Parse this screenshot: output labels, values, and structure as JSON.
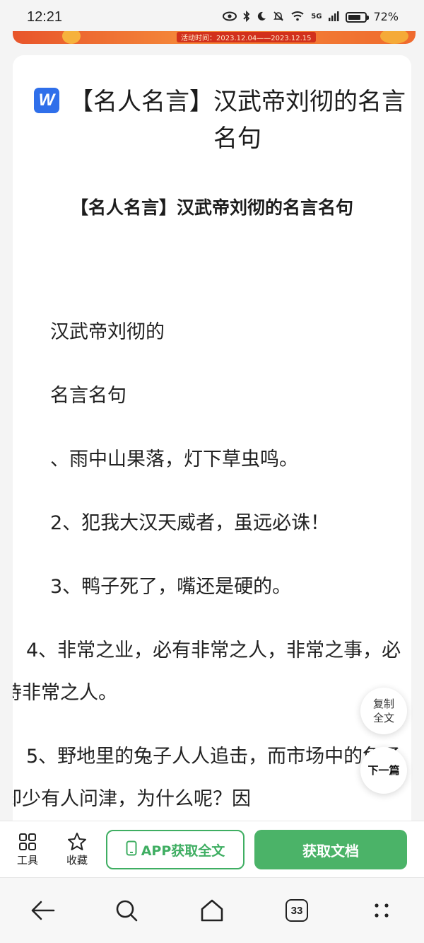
{
  "status_bar": {
    "time": "12:21",
    "network": "5G",
    "battery": "72%"
  },
  "banner": {
    "text": "活动时间：2023.12.04——2023.12.15"
  },
  "document": {
    "title": "【名人名言】汉武帝刘彻的名言名句",
    "subtitle": "【名人名言】汉武帝刘彻的名言名句",
    "paragraphs": [
      "汉武帝刘彻的",
      "名言名句",
      "、雨中山果落，灯下草虫鸣。",
      "2、犯我大汉天威者，虽远必诛！",
      "3、鸭子死了，嘴还是硬的。",
      "4、非常之业，必有非常之人，非常之事，必待非常之人。",
      "5、野地里的兔子人人追击，而市场中的兔子却少有人问津，为什么呢？因"
    ]
  },
  "floating": {
    "copy_label": "复制全文",
    "next_label": "下一篇"
  },
  "action_bar": {
    "tools_label": "工具",
    "favorite_label": "收藏",
    "app_button": "APP获取全文",
    "get_button": "获取文档"
  },
  "nav_bar": {
    "tab_count": "33"
  },
  "colors": {
    "accent_green": "#4bb368",
    "brand_blue": "#2f6fea",
    "banner_orange": "#ef6a2e"
  }
}
